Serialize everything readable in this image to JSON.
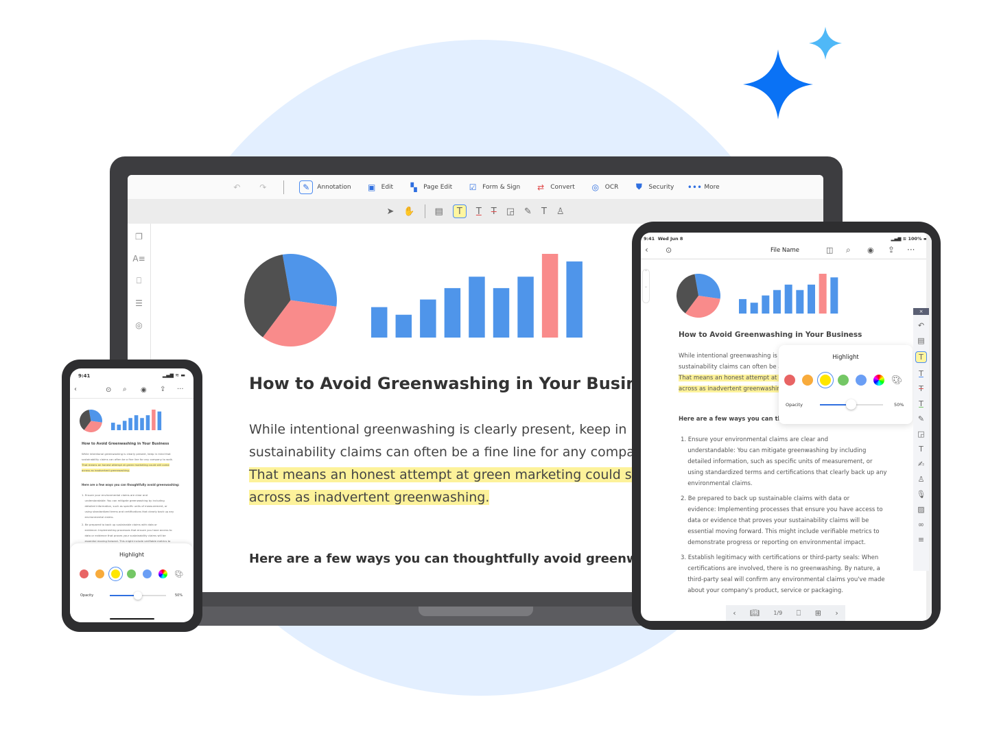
{
  "colors": {
    "accent": "#2f6fe0",
    "highlight": "#fdf29a",
    "bar_blue": "#4f95ea",
    "bar_red": "#f98b8b",
    "pie_dark": "#505050",
    "background_circle": "#e3efff",
    "star_blue": "#0a72f5",
    "star_light": "#4fb8f7"
  },
  "doc_chart": {
    "bar_values": [
      4,
      3,
      5,
      6.5,
      8,
      6.5,
      8,
      11,
      10
    ],
    "red_bar_index": 7,
    "pie_slices": [
      {
        "color": "blue",
        "share": 0.3
      },
      {
        "color": "red",
        "share": 0.33
      },
      {
        "color": "dark",
        "share": 0.37
      }
    ]
  },
  "laptop": {
    "toolbar": {
      "undo": "undo-icon",
      "redo": "redo-icon",
      "items": [
        {
          "label": "Annotation",
          "icon": "pen-icon"
        },
        {
          "label": "Edit",
          "icon": "text-box-icon"
        },
        {
          "label": "Page Edit",
          "icon": "grid-icon"
        },
        {
          "label": "Form & Sign",
          "icon": "checkbox-icon"
        },
        {
          "label": "Convert",
          "icon": "convert-icon"
        },
        {
          "label": "OCR",
          "icon": "ocr-icon"
        },
        {
          "label": "Security",
          "icon": "shield-icon"
        },
        {
          "label": "More",
          "icon": "more-icon"
        }
      ]
    },
    "subtools": [
      "select",
      "hand",
      "note",
      "highlight",
      "underline",
      "strikethrough",
      "shape",
      "pencil",
      "text",
      "stamp"
    ]
  },
  "document": {
    "title": "How to Avoid Greenwashing in Your Business",
    "p1": "While intentional greenwashing is clearly present, keep in mind that",
    "p2": "sustainability claims can often be a fine line for any company to walk.",
    "h1": "That means an honest attempt at green marketing could still come",
    "h2": "across as inadvertent greenwashing.",
    "sub": "Here are a few ways you can thoughtfully avoid greenwashing:",
    "items": [
      [
        "1. Ensure your environmental claims are clear and",
        "understandable: You can mitigate greenwashing by including",
        "detailed information, such as specific units of measurement, or",
        "using standardized terms and certifications that clearly back up any",
        "environmental claims."
      ],
      [
        "2. Be prepared to back up sustainable claims with data or",
        "evidence: Implementing processes that ensure you have access to",
        "data or evidence that proves your sustainability claims will be",
        "essential moving forward. This might include verifiable metrics to",
        "demonstrate progress or reporting on environmental impact."
      ],
      [
        "3. Establish legitimacy with certifications or third-party seals: When",
        "certifications are involved, there is no greenwashing. By nature, a",
        "third-party seal will confirm any environmental claims you've made",
        "about your company's product, service or packaging."
      ]
    ]
  },
  "tablet": {
    "time": "9:41",
    "date": "Wed Jun 8",
    "battery": "100%",
    "file_name": "File Name",
    "page": "1/9"
  },
  "phone": {
    "time": "9:41"
  },
  "highlight_panel": {
    "title": "Highlight",
    "opacity_label": "Opacity",
    "opacity_value": "50%",
    "opacity": 0.5,
    "colors": [
      "#e86464",
      "#f8ab3c",
      "#ffe600",
      "#74c765",
      "#6a9ef5"
    ],
    "selected_index": 2
  }
}
